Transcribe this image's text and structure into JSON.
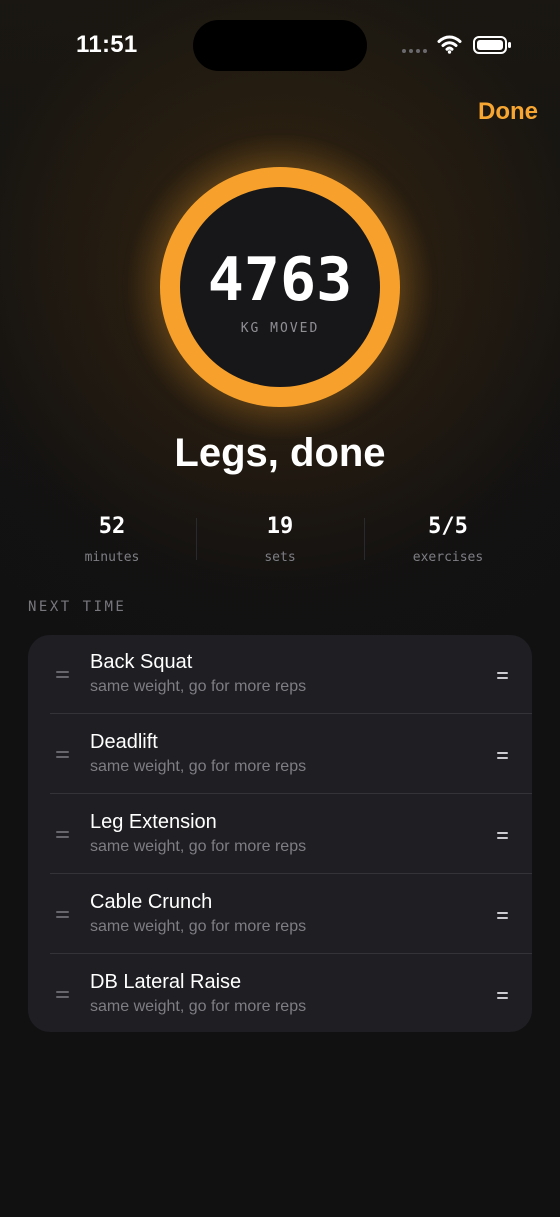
{
  "status_bar": {
    "time": "11:51",
    "icons": [
      "signal-icon",
      "wifi-icon",
      "battery-icon"
    ]
  },
  "header": {
    "done_label": "Done"
  },
  "summary": {
    "kg_moved": "4763",
    "kg_label": "KG MOVED",
    "title": "Legs, done",
    "ring_progress": 1
  },
  "stats": [
    {
      "value": "52",
      "label": "minutes"
    },
    {
      "value": "19",
      "label": "sets"
    },
    {
      "value": "5/5",
      "label": "exercises"
    }
  ],
  "next_time": {
    "label": "NEXT TIME",
    "exercises": [
      {
        "name": "Back Squat",
        "note": "same weight, go for more reps"
      },
      {
        "name": "Deadlift",
        "note": "same weight, go for more reps"
      },
      {
        "name": "Leg Extension",
        "note": "same weight, go for more reps"
      },
      {
        "name": "Cable Crunch",
        "note": "same weight, go for more reps"
      },
      {
        "name": "DB Lateral Raise",
        "note": "same weight, go for more reps"
      }
    ]
  },
  "colors": {
    "accent": "#f7a12c",
    "background": "#111112",
    "card": "#1f1f23"
  }
}
